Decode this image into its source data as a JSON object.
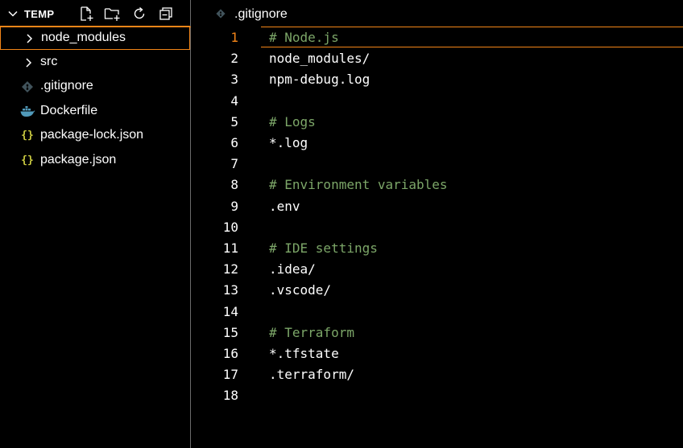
{
  "explorer": {
    "title": "TEMP",
    "items": [
      {
        "label": "node_modules",
        "type": "folder"
      },
      {
        "label": "src",
        "type": "folder"
      },
      {
        "label": ".gitignore",
        "type": "git"
      },
      {
        "label": "Dockerfile",
        "type": "docker"
      },
      {
        "label": "package-lock.json",
        "type": "json"
      },
      {
        "label": "package.json",
        "type": "json"
      }
    ]
  },
  "icons": {
    "json_glyph": "{}",
    "git_color": "#41535b",
    "docker_color": "#519aba",
    "json_color": "#cbcb41"
  },
  "editor": {
    "tab_label": ".gitignore",
    "active_line": 1,
    "lines": [
      {
        "n": "1",
        "text": "# Node.js",
        "comment": true
      },
      {
        "n": "2",
        "text": "node_modules/",
        "comment": false
      },
      {
        "n": "3",
        "text": "npm-debug.log",
        "comment": false
      },
      {
        "n": "4",
        "text": "",
        "comment": false
      },
      {
        "n": "5",
        "text": "# Logs",
        "comment": true
      },
      {
        "n": "6",
        "text": "*.log",
        "comment": false
      },
      {
        "n": "7",
        "text": "",
        "comment": false
      },
      {
        "n": "8",
        "text": "# Environment variables",
        "comment": true
      },
      {
        "n": "9",
        "text": ".env",
        "comment": false
      },
      {
        "n": "10",
        "text": "",
        "comment": false
      },
      {
        "n": "11",
        "text": "# IDE settings",
        "comment": true
      },
      {
        "n": "12",
        "text": ".idea/",
        "comment": false
      },
      {
        "n": "13",
        "text": ".vscode/",
        "comment": false
      },
      {
        "n": "14",
        "text": "",
        "comment": false
      },
      {
        "n": "15",
        "text": "# Terraform",
        "comment": true
      },
      {
        "n": "16",
        "text": "*.tfstate",
        "comment": false
      },
      {
        "n": "17",
        "text": ".terraform/",
        "comment": false
      },
      {
        "n": "18",
        "text": "",
        "comment": false
      }
    ]
  },
  "colors": {
    "accent": "#f38518",
    "comment": "#7ca668",
    "background": "#000000",
    "text": "#ffffff"
  }
}
